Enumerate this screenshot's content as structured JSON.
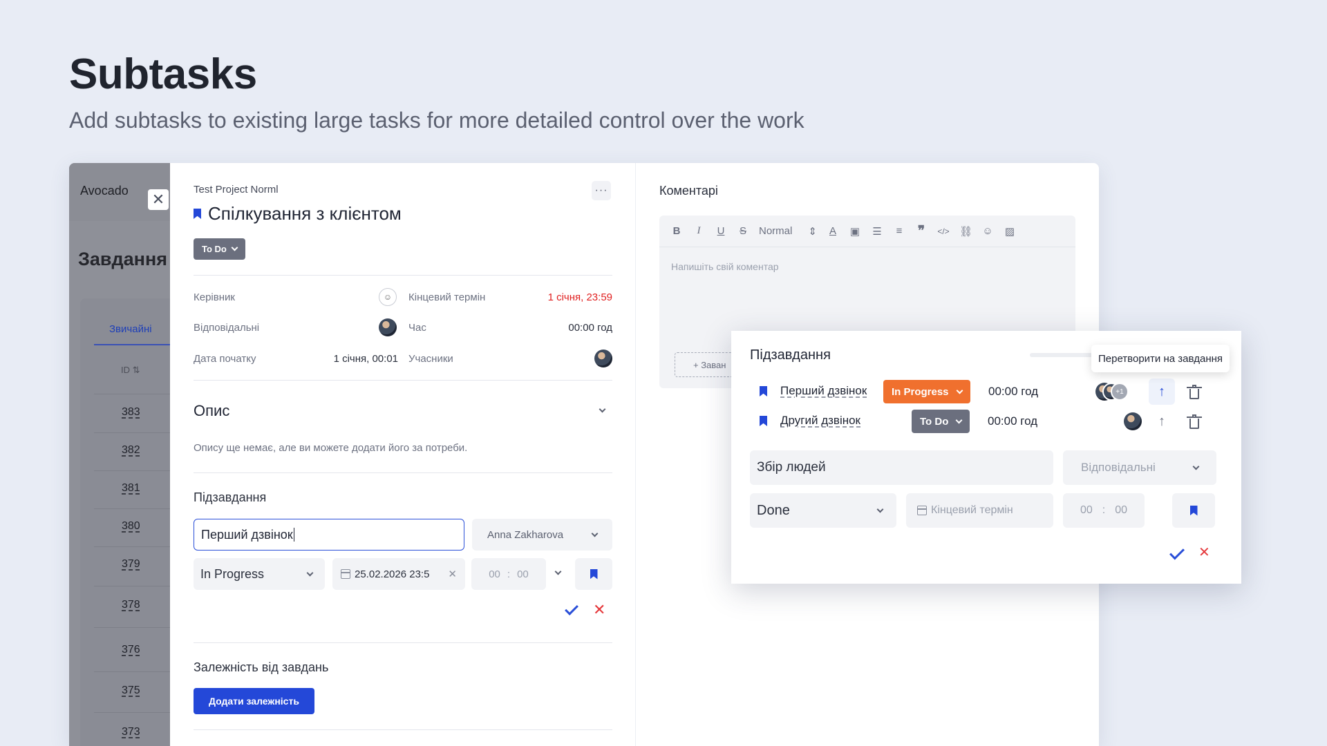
{
  "hero": {
    "title": "Subtasks",
    "subtitle": "Add subtasks to existing large tasks for more detailed control over the work"
  },
  "background_app": {
    "logo": "Avocado",
    "heading": "Завдання",
    "tab": "Звичайні",
    "id_header": "ID",
    "ids": [
      "383",
      "382",
      "381",
      "380",
      "379",
      "378",
      "376",
      "375",
      "373"
    ]
  },
  "task": {
    "project": "Test Project Norml",
    "more_label": "···",
    "title": "Спілкування з клієнтом",
    "status": "To Do",
    "fields": {
      "manager_label": "Керівник",
      "deadline_label": "Кінцевий термін",
      "deadline_value": "1 січня, 23:59",
      "assignees_label": "Відповідальні",
      "time_label": "Час",
      "time_value": "00:00 год",
      "start_label": "Дата початку",
      "start_value": "1 січня, 00:01",
      "participants_label": "Учасники"
    },
    "description": {
      "title": "Опис",
      "empty": "Опису ще немає, але ви можете додати його за потреби."
    },
    "subtasks": {
      "title": "Підзавдання",
      "name_value": "Перший дзвінок",
      "assignee_value": "Anna Zakharova",
      "status_value": "In Progress",
      "date_value": "25.02.2026 23:5",
      "hours_placeholder": "00",
      "minutes_placeholder": "00",
      "time_separator": ":"
    },
    "dependencies": {
      "title": "Залежність від завдань",
      "button": "Додати залежність"
    }
  },
  "comments": {
    "title": "Коментарі",
    "toolbar_format": "Normal",
    "placeholder": "Напишіть свій коментар",
    "attach_label": "+ Заван"
  },
  "subtask_card": {
    "title": "Підзавдання",
    "tooltip": "Перетворити на завдання",
    "items": [
      {
        "name": "Перший дзвінок",
        "status": "In Progress",
        "time": "00:00 год",
        "extra_count": "+1"
      },
      {
        "name": "Другий дзвінок",
        "status": "To Do",
        "time": "00:00 год"
      }
    ],
    "new": {
      "name_value": "Збір людей",
      "assignee_placeholder": "Відповідальні",
      "status_value": "Done",
      "deadline_placeholder": "Кінцевий термін",
      "hours_placeholder": "00",
      "minutes_placeholder": "00",
      "time_separator": ":"
    }
  },
  "colors": {
    "accent": "#2448d8",
    "in_progress": "#f0702e",
    "todo": "#6b6f7e",
    "danger": "#e5393c",
    "deadline": "#e01f1f"
  }
}
